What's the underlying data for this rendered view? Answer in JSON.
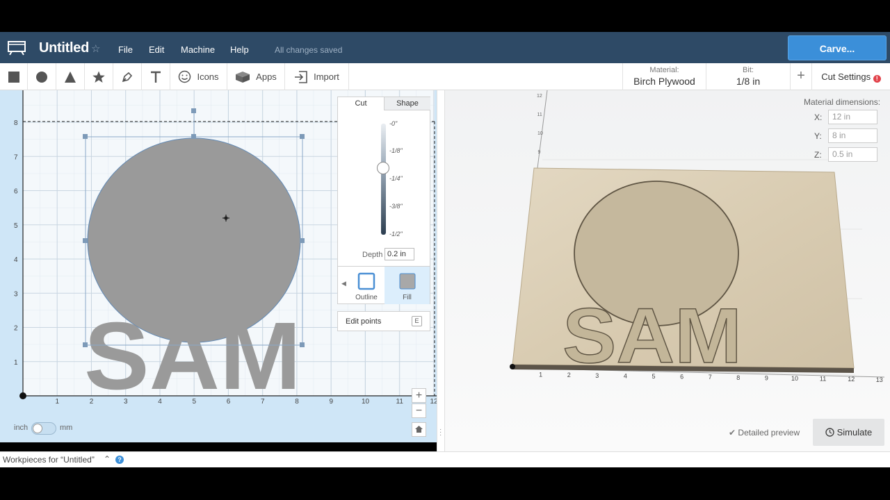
{
  "header": {
    "title": "Untitled",
    "menus": [
      "File",
      "Edit",
      "Machine",
      "Help"
    ],
    "save_status": "All changes saved",
    "carve_label": "Carve..."
  },
  "toolbar": {
    "icons_label": "Icons",
    "apps_label": "Apps",
    "import_label": "Import",
    "material_key": "Material:",
    "material_value": "Birch Plywood",
    "bit_key": "Bit:",
    "bit_value": "1/8 in",
    "cut_settings_label": "Cut Settings"
  },
  "design": {
    "y_ticks": [
      "8",
      "7",
      "6",
      "5",
      "4",
      "3",
      "2",
      "1"
    ],
    "x_ticks": [
      "1",
      "2",
      "3",
      "4",
      "5",
      "6",
      "7",
      "8",
      "9",
      "10",
      "11",
      "12"
    ],
    "text": "SAM",
    "unit_inch": "inch",
    "unit_mm": "mm"
  },
  "cut_panel": {
    "tab_cut": "Cut",
    "tab_shape": "Shape",
    "depth_ticks": [
      "-0\"",
      "-1/8\"",
      "-1/4\"",
      "-3/8\"",
      "-1/2\""
    ],
    "depth_label": "Depth",
    "depth_value": "0.2 in",
    "outline_label": "Outline",
    "fill_label": "Fill",
    "edit_points_label": "Edit points",
    "edit_points_key": "E"
  },
  "preview": {
    "material_dims_label": "Material dimensions:",
    "x_label": "X:",
    "x_value": "12 in",
    "y_label": "Y:",
    "y_value": "8 in",
    "z_label": "Z:",
    "z_value": "0.5 in",
    "detailed_label": "Detailed preview",
    "simulate_label": "Simulate",
    "x_axis_ticks": [
      "1",
      "2",
      "3",
      "4",
      "5",
      "6",
      "7",
      "8",
      "9",
      "10",
      "11",
      "12",
      "13"
    ],
    "y_axis_ticks": [
      "12",
      "11",
      "10",
      "9"
    ]
  },
  "footer": {
    "workpieces_label": "Workpieces for “Untitled”"
  }
}
